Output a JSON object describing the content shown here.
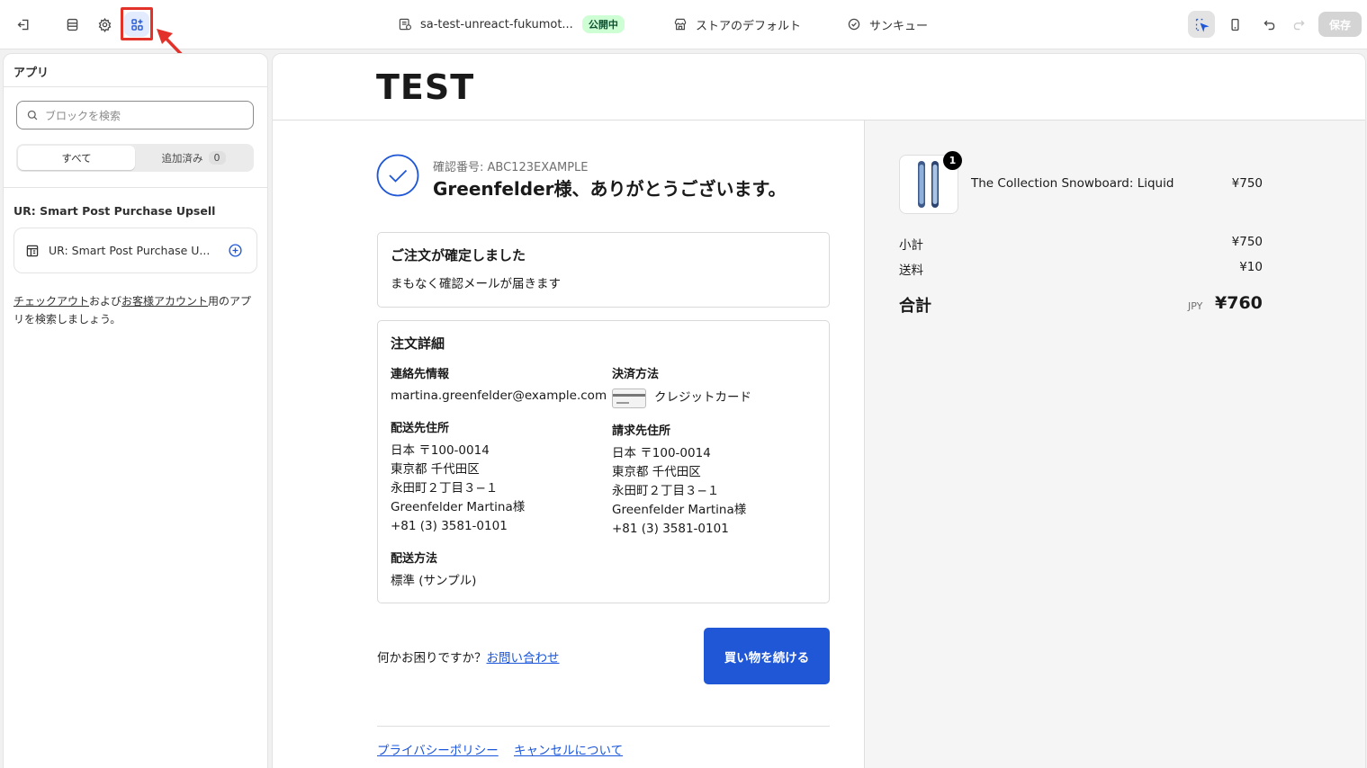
{
  "topbar": {
    "store_name": "sa-test-unreact-fukumot...",
    "status_badge": "公開中",
    "theme_label": "ストアのデフォルト",
    "page_label": "サンキュー",
    "save_label": "保存"
  },
  "sidebar": {
    "title": "アプリ",
    "search_placeholder": "ブロックを検索",
    "tab_all": "すべて",
    "tab_added": "追加済み",
    "tab_added_count": "0",
    "section_title": "UR: Smart Post Purchase Upsell",
    "app_item": "UR: Smart Post Purchase U...",
    "help_link_checkout": "チェックアウト",
    "help_text_and": "および",
    "help_link_account": "お客様アカウント",
    "help_text_tail": "用のアプリを検索しましょう。"
  },
  "preview": {
    "logo": "TEST",
    "confirmation_number": "確認番号: ABC123EXAMPLE",
    "thanks_heading": "Greenfelder様、ありがとうございます。",
    "order_confirmed_title": "ご注文が確定しました",
    "order_confirmed_text": "まもなく確認メールが届きます",
    "order_details_title": "注文詳細",
    "contact_label": "連絡先情報",
    "contact_email": "martina.greenfelder@example.com",
    "shipping_address_label": "配送先住所",
    "shipping_address": [
      "日本 〒100-0014",
      "東京都 千代田区",
      "永田町２丁目３−１",
      "Greenfelder Martina様",
      "+81 (3) 3581-0101"
    ],
    "shipping_method_label": "配送方法",
    "shipping_method": "標準 (サンプル)",
    "payment_label": "決済方法",
    "payment_method": "クレジットカード",
    "billing_address_label": "請求先住所",
    "billing_address": [
      "日本 〒100-0014",
      "東京都 千代田区",
      "永田町２丁目３−１",
      "Greenfelder Martina様",
      "+81 (3) 3581-0101"
    ],
    "help_question": "何かお困りですか？",
    "help_contact_link": "お問い合わせ",
    "continue_button": "買い物を続ける",
    "footer_privacy": "プライバシーポリシー",
    "footer_cancel": "キャンセルについて"
  },
  "summary": {
    "product_name": "The Collection Snowboard: Liquid",
    "product_qty": "1",
    "product_price": "¥750",
    "subtotal_label": "小計",
    "subtotal_value": "¥750",
    "shipping_label": "送料",
    "shipping_value": "¥10",
    "total_label": "合計",
    "currency": "JPY",
    "total_value": "¥760"
  }
}
